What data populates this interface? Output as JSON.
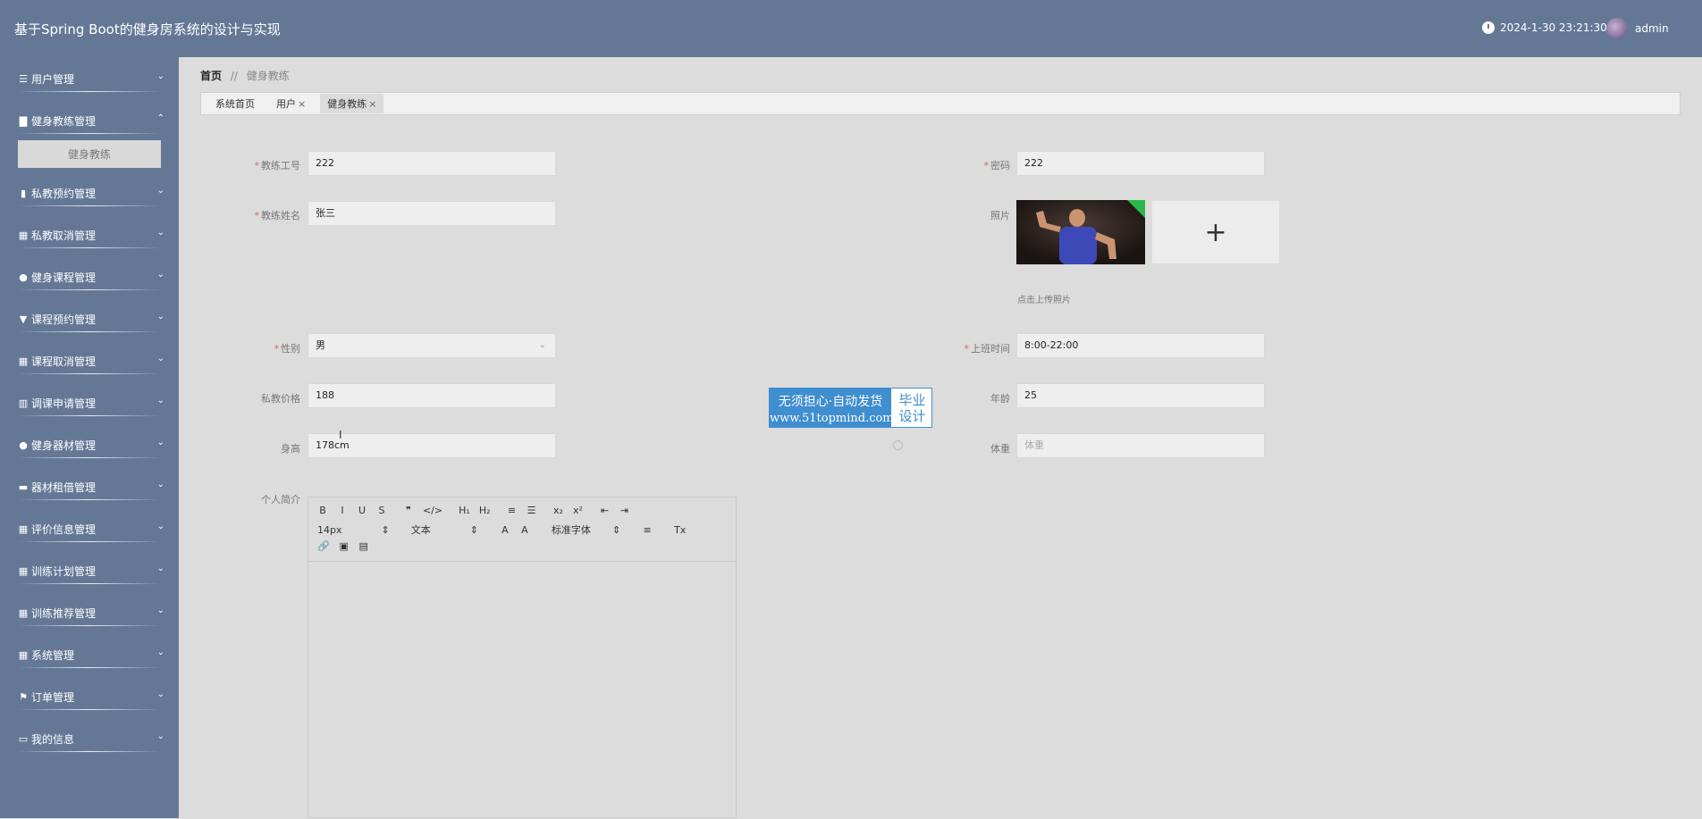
{
  "app": {
    "title": "基于Spring Boot的健身房系统的设计与实现"
  },
  "header": {
    "datetime": "2024-1-30 23:21:30",
    "username": "admin"
  },
  "sidebar": {
    "items": [
      {
        "label": "用户管理",
        "icon": "sliders-icon",
        "chevron": "⌄"
      },
      {
        "label": "健身教练管理",
        "icon": "briefcase-icon",
        "chevron": "⌃",
        "sub": [
          "健身教练"
        ]
      },
      {
        "label": "私教预约管理",
        "icon": "clipboard-icon",
        "chevron": "⌄"
      },
      {
        "label": "私教取消管理",
        "icon": "grid-icon",
        "chevron": "⌄"
      },
      {
        "label": "健身课程管理",
        "icon": "location-icon",
        "chevron": "⌄"
      },
      {
        "label": "课程预约管理",
        "icon": "shield-icon",
        "chevron": "⌄"
      },
      {
        "label": "课程取消管理",
        "icon": "table-icon",
        "chevron": "⌄"
      },
      {
        "label": "调课申请管理",
        "icon": "chart-icon",
        "chevron": "⌄"
      },
      {
        "label": "健身器材管理",
        "icon": "user-icon",
        "chevron": "⌄"
      },
      {
        "label": "器材租借管理",
        "icon": "hand-icon",
        "chevron": "⌄"
      },
      {
        "label": "评价信息管理",
        "icon": "grid-icon",
        "chevron": "⌄"
      },
      {
        "label": "训练计划管理",
        "icon": "grid-icon",
        "chevron": "⌄"
      },
      {
        "label": "训练推荐管理",
        "icon": "grid-icon",
        "chevron": "⌄"
      },
      {
        "label": "系统管理",
        "icon": "grid-icon",
        "chevron": "⌄"
      },
      {
        "label": "订单管理",
        "icon": "flag-icon",
        "chevron": "⌄"
      },
      {
        "label": "我的信息",
        "icon": "window-icon",
        "chevron": "⌄"
      }
    ]
  },
  "breadcrumb": {
    "home": "首页",
    "sep": "//",
    "current": "健身教练"
  },
  "tabs": [
    {
      "label": "系统首页",
      "closable": false
    },
    {
      "label": "用户",
      "closable": true
    },
    {
      "label": "健身教练",
      "closable": true,
      "active": true
    }
  ],
  "form": {
    "coach_no": {
      "label": "教练工号",
      "value": "222",
      "required": true
    },
    "password": {
      "label": "密码",
      "value": "222",
      "required": true
    },
    "coach_name": {
      "label": "教练姓名",
      "value": "张三",
      "required": true
    },
    "photo": {
      "label": "照片",
      "tip": "点击上传照片",
      "add": "+"
    },
    "gender": {
      "label": "性别",
      "value": "男",
      "required": true
    },
    "work_time": {
      "label": "上班时间",
      "value": "8:00-22:00",
      "required": true
    },
    "price": {
      "label": "私教价格",
      "value": "188"
    },
    "age": {
      "label": "年龄",
      "value": "25"
    },
    "height": {
      "label": "身高",
      "value": "178cm"
    },
    "weight": {
      "label": "体重",
      "placeholder": "体重"
    },
    "bio": {
      "label": "个人简介"
    }
  },
  "editor": {
    "row1": [
      "B",
      "I",
      "U",
      "S",
      "❞",
      "</>",
      "H₁",
      "H₂",
      "≡",
      "☰",
      "x₂",
      "x²",
      "⇤",
      "⇥"
    ],
    "font_size": "14px",
    "text_type": "文本",
    "font_family": "标准字体",
    "row2_icons": [
      "A",
      "A",
      "≡",
      "Tx"
    ]
  },
  "watermark": {
    "line1": "无须担心·自动发货",
    "line2": "www.51topmind.com",
    "right1": "毕业",
    "right2": "设计"
  },
  "colors": {
    "primary": "#647896",
    "required": "#e65c5c",
    "watermark": "#3e8ed0"
  }
}
